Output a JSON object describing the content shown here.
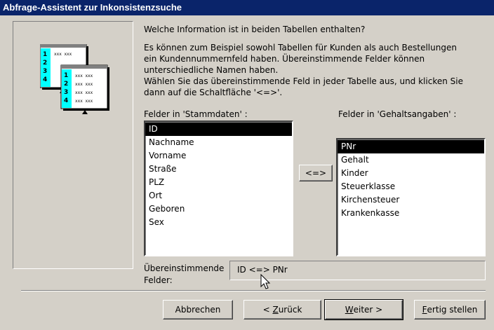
{
  "window": {
    "title": "Abfrage-Assistent zur Inkonsistenzsuche"
  },
  "illustration": {
    "front_numbers": [
      "1",
      "2",
      "3",
      "4"
    ],
    "placeholder": "xxx xxx"
  },
  "instructions": {
    "question": "Welche Information ist in beiden Tabellen enthalten?",
    "lines": [
      "Es können zum Beispiel sowohl Tabellen für Kunden als auch Bestellungen",
      "ein Kundennummernfeld haben. Übereinstimmende Felder können",
      "unterschiedliche Namen haben.",
      "Wählen Sie das übereinstimmende Feld in jeder Tabelle aus, und klicken Sie",
      "dann auf die Schaltfläche '<=>'."
    ]
  },
  "left_list": {
    "label": "Felder in 'Stammdaten' :",
    "items": [
      "ID",
      "Nachname",
      "Vorname",
      "Straße",
      "PLZ",
      "Ort",
      "Geboren",
      "Sex"
    ],
    "selected": "ID"
  },
  "right_list": {
    "label": "Felder in 'Gehaltsangaben' :",
    "items": [
      "PNr",
      "Gehalt",
      "Kinder",
      "Steuerklasse",
      "Kirchensteuer",
      "Krankenkasse"
    ],
    "selected": "PNr"
  },
  "match_button": {
    "label": "<=>"
  },
  "matching_fields": {
    "label_line1": "Übereinstimmende",
    "label_line2": "Felder:",
    "value": "ID <=> PNr"
  },
  "buttons": {
    "cancel": "Abbrechen",
    "back_prefix": "< ",
    "back_accel": "Z",
    "back_rest": "urück",
    "next_accel": "W",
    "next_rest": "eiter >",
    "finish_accel": "F",
    "finish_rest": "ertig stellen"
  }
}
